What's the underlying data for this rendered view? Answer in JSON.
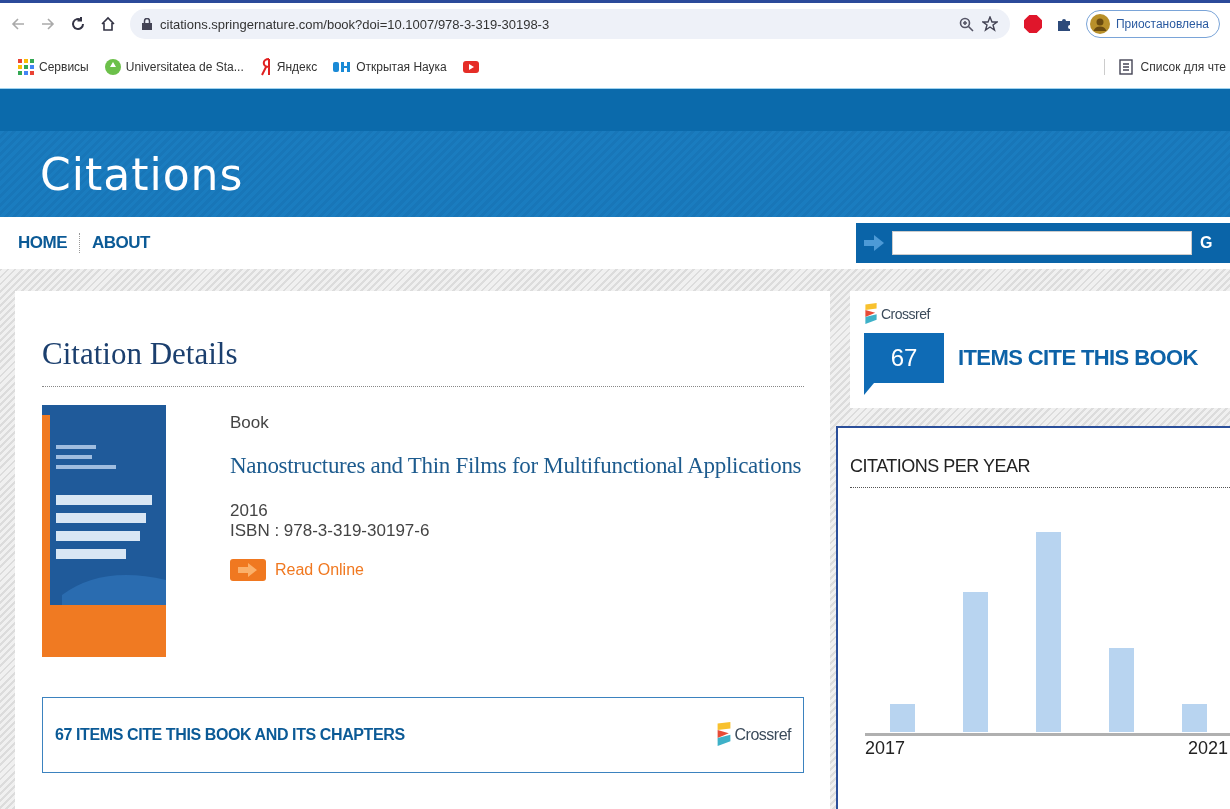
{
  "browser": {
    "url": "citations.springernature.com/book?doi=10.1007/978-3-319-30198-3",
    "profile": "Приостановлена",
    "bookmarks": [
      {
        "kind": "apps",
        "label": "Сервисы"
      },
      {
        "kind": "site",
        "label": "Universitatea de Sta..."
      },
      {
        "kind": "yandex",
        "label": "Яндекс"
      },
      {
        "kind": "science",
        "label": "Открытая Наука"
      },
      {
        "kind": "video"
      }
    ],
    "reading_list": "Список для чте"
  },
  "site": {
    "title": "Citations",
    "nav": [
      {
        "label": "HOME"
      },
      {
        "label": "ABOUT"
      }
    ],
    "search_button": "G"
  },
  "details": {
    "heading": "Citation Details",
    "type": "Book",
    "title": "Nanostructures and Thin Films for Multifunctional Applications",
    "year": "2016",
    "isbn": "ISBN : 978-3-319-30197-6",
    "read_online": "Read Online",
    "citing_banner": "67 ITEMS CITE THIS BOOK AND ITS CHAPTERS",
    "crossref": "Crossref"
  },
  "side": {
    "crossref": "Crossref",
    "count": "67",
    "count_label": "ITEMS CITE THIS BOOK",
    "chart": {
      "title": "CITATIONS PER YEAR",
      "x_labels": [
        "2017",
        "2021"
      ]
    }
  }
}
